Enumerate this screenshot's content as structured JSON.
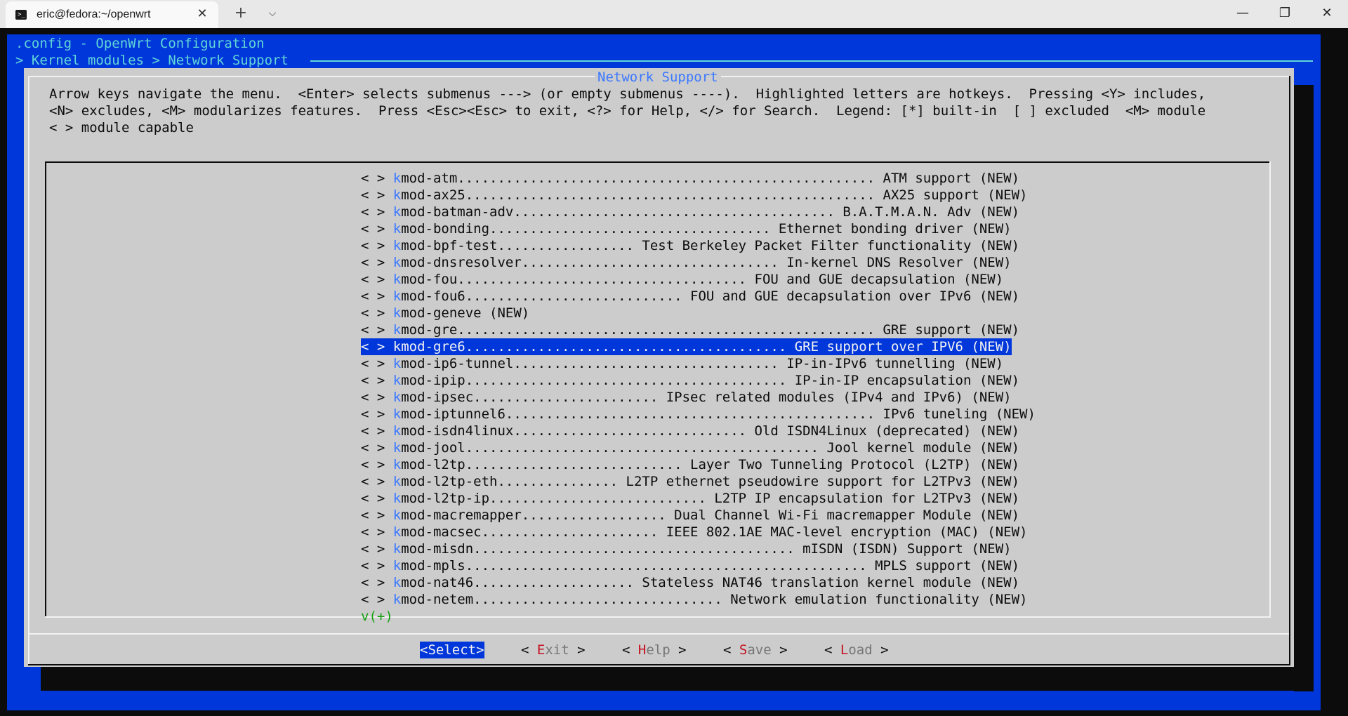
{
  "window": {
    "tab_title": "eric@fedora:~/openwrt",
    "tab_icon_glyph": ">_",
    "close_glyph": "✕",
    "new_tab_glyph": "+",
    "dropdown_glyph": "⌵",
    "minimize_glyph": "—",
    "maximize_glyph": "❐",
    "window_close_glyph": "✕"
  },
  "header": {
    "title": ".config - OpenWrt Configuration",
    "breadcrumb": "> Kernel modules > Network Support"
  },
  "dialog": {
    "title": "Network Support",
    "help_lines": [
      "Arrow keys navigate the menu.  <Enter> selects submenus ---> (or empty submenus ----).  Highlighted letters are hotkeys.  Pressing <Y> includes,",
      "<N> excludes, <M> modularizes features.  Press <Esc><Esc> to exit, <?> for Help, </> for Search.  Legend: [*] built-in  [ ] excluded  <M> module",
      "< > module capable"
    ]
  },
  "menu": {
    "more_indicator": "v(+)",
    "selected_index": 10,
    "items": [
      {
        "prefix": "< > ",
        "hotkey": "k",
        "text": "mod-atm.................................................... ATM support (NEW)"
      },
      {
        "prefix": "< > ",
        "hotkey": "k",
        "text": "mod-ax25................................................... AX25 support (NEW)"
      },
      {
        "prefix": "< > ",
        "hotkey": "k",
        "text": "mod-batman-adv........................................ B.A.T.M.A.N. Adv (NEW)"
      },
      {
        "prefix": "< > ",
        "hotkey": "k",
        "text": "mod-bonding................................... Ethernet bonding driver (NEW)"
      },
      {
        "prefix": "< > ",
        "hotkey": "k",
        "text": "mod-bpf-test................. Test Berkeley Packet Filter functionality (NEW)"
      },
      {
        "prefix": "< > ",
        "hotkey": "k",
        "text": "mod-dnsresolver................................ In-kernel DNS Resolver (NEW)"
      },
      {
        "prefix": "< > ",
        "hotkey": "k",
        "text": "mod-fou.................................... FOU and GUE decapsulation (NEW)"
      },
      {
        "prefix": "< > ",
        "hotkey": "k",
        "text": "mod-fou6........................... FOU and GUE decapsulation over IPv6 (NEW)"
      },
      {
        "prefix": "< > ",
        "hotkey": "k",
        "text": "mod-geneve (NEW)"
      },
      {
        "prefix": "< > ",
        "hotkey": "k",
        "text": "mod-gre.................................................... GRE support (NEW)"
      },
      {
        "prefix": "< > ",
        "hotkey": "k",
        "text": "mod-gre6........................................ GRE support over IPV6 (NEW)"
      },
      {
        "prefix": "< > ",
        "hotkey": "k",
        "text": "mod-ip6-tunnel................................. IP-in-IPv6 tunnelling (NEW)"
      },
      {
        "prefix": "< > ",
        "hotkey": "k",
        "text": "mod-ipip........................................ IP-in-IP encapsulation (NEW)"
      },
      {
        "prefix": "< > ",
        "hotkey": "k",
        "text": "mod-ipsec....................... IPsec related modules (IPv4 and IPv6) (NEW)"
      },
      {
        "prefix": "< > ",
        "hotkey": "k",
        "text": "mod-iptunnel6.............................................. IPv6 tuneling (NEW)"
      },
      {
        "prefix": "< > ",
        "hotkey": "k",
        "text": "mod-isdn4linux............................. Old ISDN4Linux (deprecated) (NEW)"
      },
      {
        "prefix": "< > ",
        "hotkey": "k",
        "text": "mod-jool............................................ Jool kernel module (NEW)"
      },
      {
        "prefix": "< > ",
        "hotkey": "k",
        "text": "mod-l2tp........................... Layer Two Tunneling Protocol (L2TP) (NEW)"
      },
      {
        "prefix": "< > ",
        "hotkey": "k",
        "text": "mod-l2tp-eth............... L2TP ethernet pseudowire support for L2TPv3 (NEW)"
      },
      {
        "prefix": "< > ",
        "hotkey": "k",
        "text": "mod-l2tp-ip........................... L2TP IP encapsulation for L2TPv3 (NEW)"
      },
      {
        "prefix": "< > ",
        "hotkey": "k",
        "text": "mod-macremapper.................. Dual Channel Wi-Fi macremapper Module (NEW)"
      },
      {
        "prefix": "< > ",
        "hotkey": "k",
        "text": "mod-macsec...................... IEEE 802.1AE MAC-level encryption (MAC) (NEW)"
      },
      {
        "prefix": "< > ",
        "hotkey": "k",
        "text": "mod-misdn........................................ mISDN (ISDN) Support (NEW)"
      },
      {
        "prefix": "< > ",
        "hotkey": "k",
        "text": "mod-mpls.................................................. MPLS support (NEW)"
      },
      {
        "prefix": "< > ",
        "hotkey": "k",
        "text": "mod-nat46.................... Stateless NAT46 translation kernel module (NEW)"
      },
      {
        "prefix": "< > ",
        "hotkey": "k",
        "text": "mod-netem............................... Network emulation functionality (NEW)"
      }
    ]
  },
  "buttons": [
    {
      "pre": "<",
      "hotkey": "",
      "rest": "Select",
      "post": ">",
      "active": true
    },
    {
      "pre": "< ",
      "hotkey": "E",
      "rest": "xit",
      "post": " >",
      "active": false
    },
    {
      "pre": "< ",
      "hotkey": "H",
      "rest": "elp",
      "post": " >",
      "active": false
    },
    {
      "pre": "< ",
      "hotkey": "S",
      "rest": "ave",
      "post": " >",
      "active": false
    },
    {
      "pre": "< ",
      "hotkey": "L",
      "rest": "oad",
      "post": " >",
      "active": false
    }
  ],
  "colors": {
    "terminal_blue": "#0037da",
    "dialog_gray": "#cccccc",
    "hotkey_blue": "#3b78ff",
    "hotkey_red": "#c50f1f",
    "header_cyan": "#61d6d6",
    "more_green": "#13a10e"
  }
}
